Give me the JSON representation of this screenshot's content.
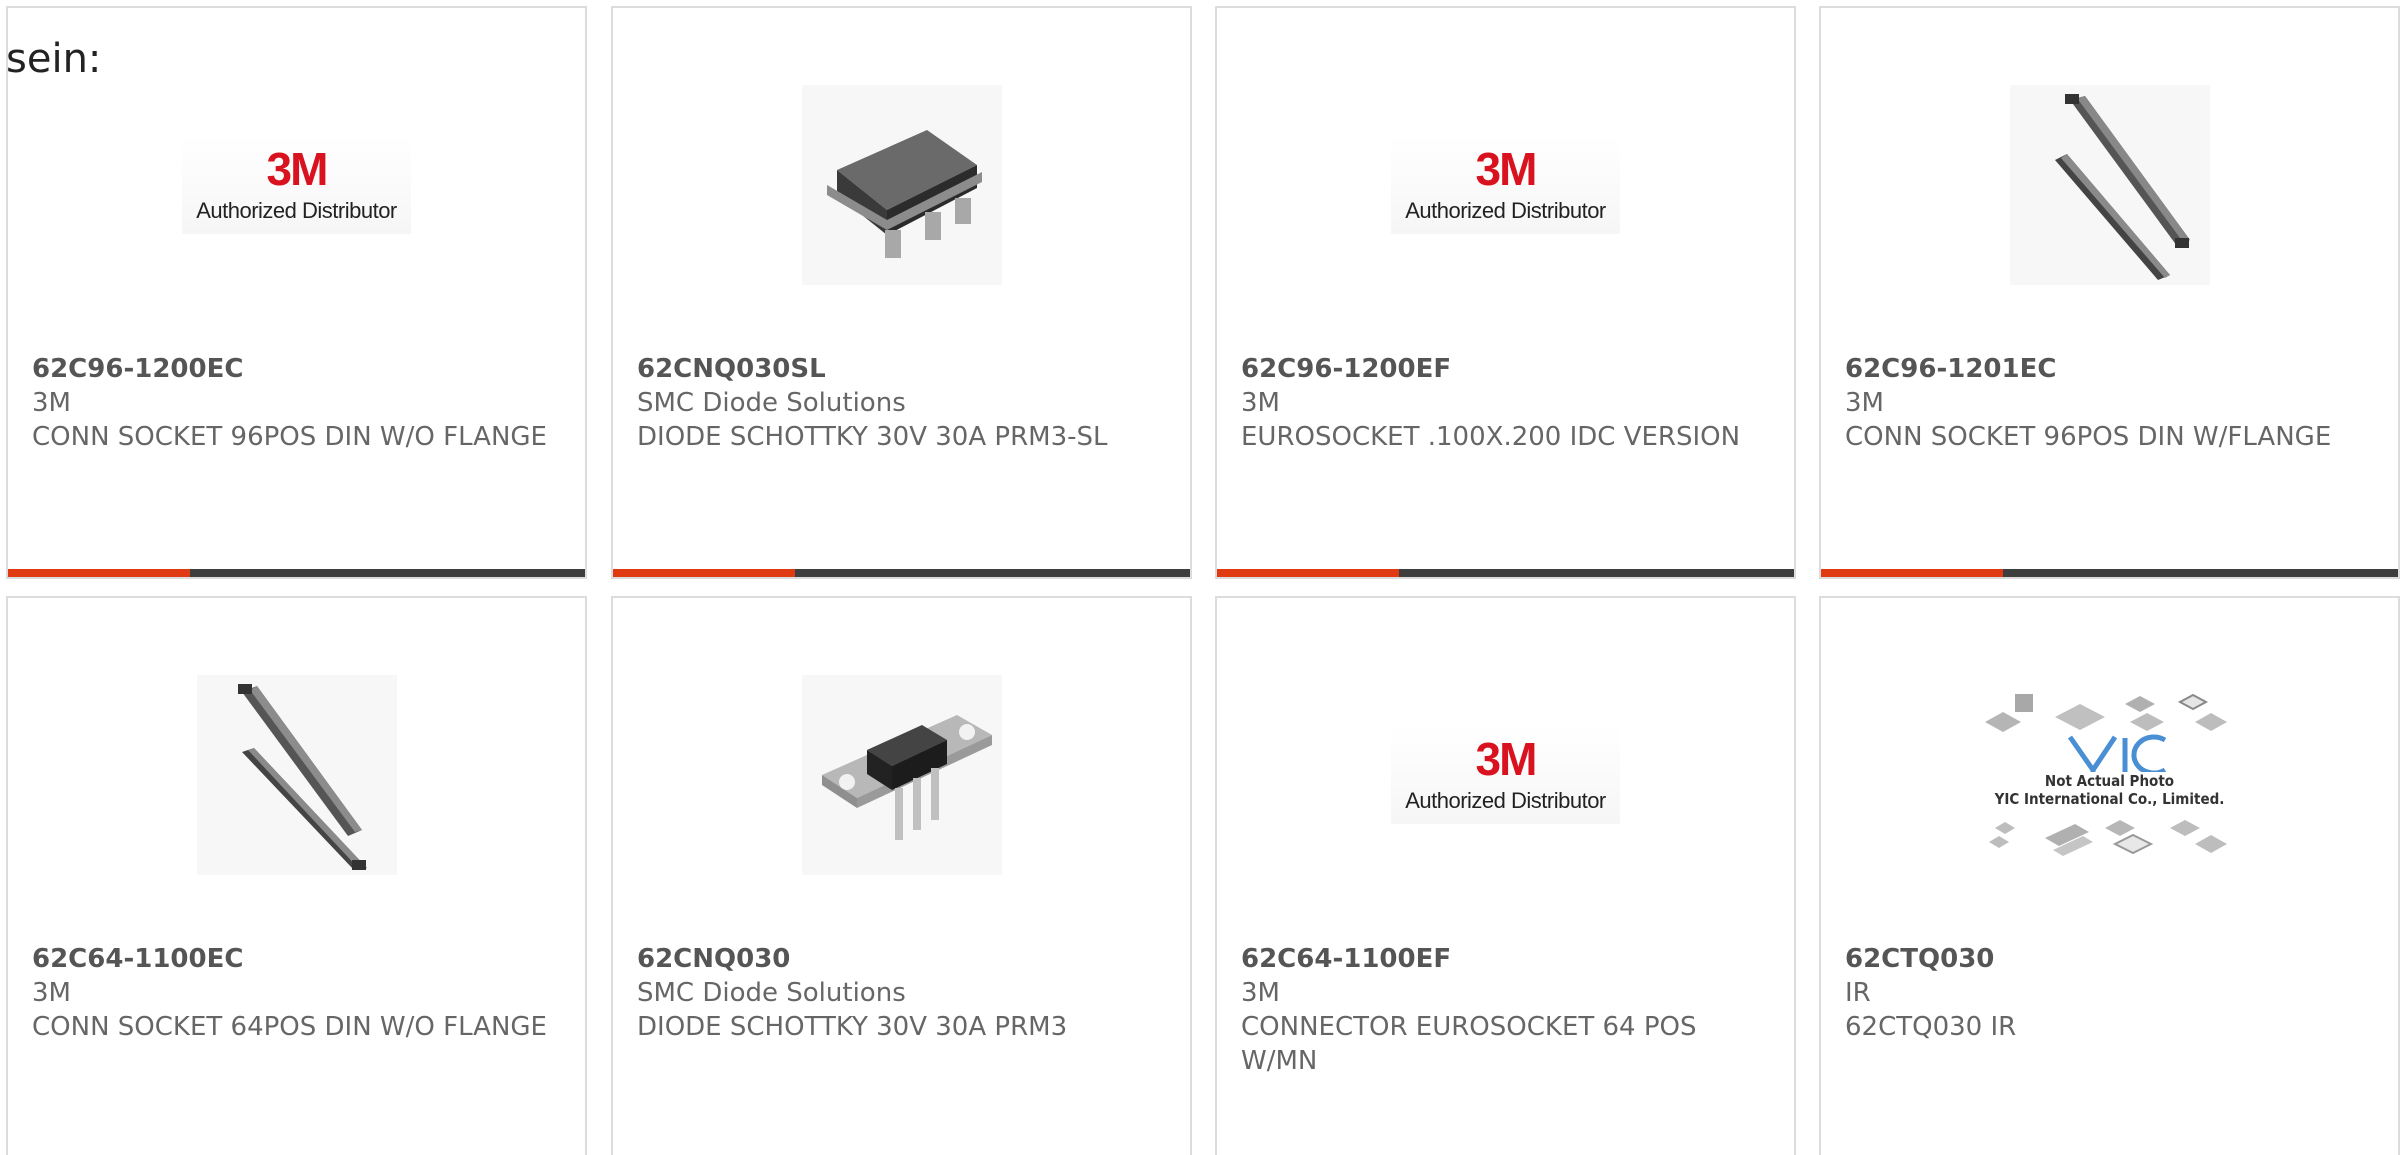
{
  "lead_text": "sein:",
  "logo_text": {
    "mark": "3M",
    "sub": "Authorized Distributor"
  },
  "yic_caption": {
    "line1": "Not Actual Photo",
    "line2": "YIC International Co., Limited."
  },
  "colors": {
    "accent": "#e03a12",
    "bar": "#3e3e3e",
    "border": "#dcdcdc",
    "text": "#666666",
    "brand_3m": "#d8121e"
  },
  "products": [
    {
      "part": "62C96-1200EC",
      "manufacturer": "3M",
      "description": "CONN SOCKET 96POS DIN W/O FLANGE",
      "image": "3m-logo"
    },
    {
      "part": "62CNQ030SL",
      "manufacturer": "SMC Diode Solutions",
      "description": "DIODE SCHOTTKY 30V 30A PRM3-SL",
      "image": "diode-smd-photo"
    },
    {
      "part": "62C96-1200EF",
      "manufacturer": "3M",
      "description": "EUROSOCKET .100X.200 IDC VERSION",
      "image": "3m-logo"
    },
    {
      "part": "62C96-1201EC",
      "manufacturer": "3M",
      "description": "CONN SOCKET 96POS DIN W/FLANGE",
      "image": "connector-rails-photo"
    },
    {
      "part": "62C64-1100EC",
      "manufacturer": "3M",
      "description": "CONN SOCKET 64POS DIN W/O FLANGE",
      "image": "connector-rails-photo"
    },
    {
      "part": "62CNQ030",
      "manufacturer": "SMC Diode Solutions",
      "description": "DIODE SCHOTTKY 30V 30A PRM3",
      "image": "diode-tab-photo"
    },
    {
      "part": "62C64-1100EF",
      "manufacturer": "3M",
      "description": "CONNECTOR EUROSOCKET 64 POS W/MN",
      "image": "3m-logo"
    },
    {
      "part": "62CTQ030",
      "manufacturer": "IR",
      "description": "62CTQ030 IR",
      "image": "yic-placeholder"
    }
  ]
}
